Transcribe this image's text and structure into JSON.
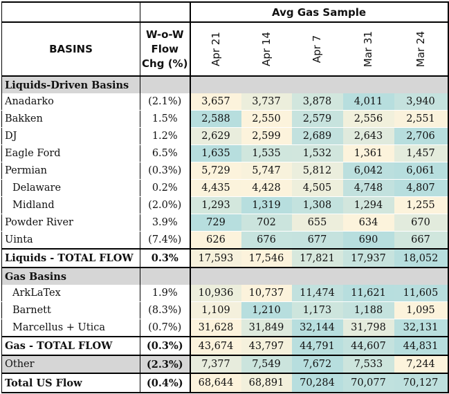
{
  "header": {
    "group_label": "Avg Gas Sample",
    "basins_label": "BASINS",
    "flow_line1": "W-o-W",
    "flow_line2": "Flow",
    "flow_line3": "Chg (%)",
    "dates": [
      "Apr 21",
      "Apr 14",
      "Apr 7",
      "Mar 31",
      "Mar 24"
    ]
  },
  "colors": {
    "teal": "#b7dede",
    "cream": "#fcf3dc",
    "mid": "#dbe9dd",
    "section_gray": "#d6d6d6"
  },
  "sections": {
    "liquids": "Liquids-Driven Basins",
    "gas": "Gas Basins"
  },
  "liquids_rows": [
    {
      "name": "Anadarko",
      "chg": "(2.1%)",
      "vals": [
        "3,657",
        "3,737",
        "3,878",
        "4,011",
        "3,940"
      ]
    },
    {
      "name": "Bakken",
      "chg": "1.5%",
      "vals": [
        "2,588",
        "2,550",
        "2,579",
        "2,556",
        "2,551"
      ]
    },
    {
      "name": "DJ",
      "chg": "1.2%",
      "vals": [
        "2,629",
        "2,599",
        "2,689",
        "2,643",
        "2,706"
      ]
    },
    {
      "name": "Eagle Ford",
      "chg": "6.5%",
      "vals": [
        "1,635",
        "1,535",
        "1,532",
        "1,361",
        "1,457"
      ]
    },
    {
      "name": "Permian",
      "chg": "(0.3%)",
      "vals": [
        "5,729",
        "5,747",
        "5,812",
        "6,042",
        "6,061"
      ]
    },
    {
      "name": "Delaware",
      "chg": "0.2%",
      "vals": [
        "4,435",
        "4,428",
        "4,505",
        "4,748",
        "4,807"
      ]
    },
    {
      "name": "Midland",
      "chg": "(2.0%)",
      "vals": [
        "1,293",
        "1,319",
        "1,308",
        "1,294",
        "1,255"
      ]
    },
    {
      "name": "Powder River",
      "chg": "3.9%",
      "vals": [
        "729",
        "702",
        "655",
        "634",
        "670"
      ]
    },
    {
      "name": "Uinta",
      "chg": "(7.4%)",
      "vals": [
        "626",
        "676",
        "677",
        "690",
        "667"
      ]
    }
  ],
  "liquids_total": {
    "name": "Liquids - TOTAL FLOW",
    "chg": "0.3%",
    "vals": [
      "17,593",
      "17,546",
      "17,821",
      "17,937",
      "18,052"
    ]
  },
  "gas_rows": [
    {
      "name": "ArkLaTex",
      "chg": "1.9%",
      "vals": [
        "10,936",
        "10,737",
        "11,474",
        "11,621",
        "11,605"
      ]
    },
    {
      "name": "Barnett",
      "chg": "(8.3%)",
      "vals": [
        "1,109",
        "1,210",
        "1,173",
        "1,188",
        "1,095"
      ]
    },
    {
      "name": "Marcellus + Utica",
      "chg": "(0.7%)",
      "vals": [
        "31,628",
        "31,849",
        "32,144",
        "31,798",
        "32,131"
      ]
    }
  ],
  "gas_total": {
    "name": "Gas - TOTAL FLOW",
    "chg": "(0.3%)",
    "vals": [
      "43,674",
      "43,797",
      "44,791",
      "44,607",
      "44,831"
    ]
  },
  "other": {
    "name": "Other",
    "chg": "(2.3%)",
    "vals": [
      "7,377",
      "7,549",
      "7,672",
      "7,533",
      "7,244"
    ]
  },
  "grand_total": {
    "name": "Total US Flow",
    "chg": "(0.4%)",
    "vals": [
      "68,644",
      "68,891",
      "70,284",
      "70,077",
      "70,127"
    ]
  }
}
